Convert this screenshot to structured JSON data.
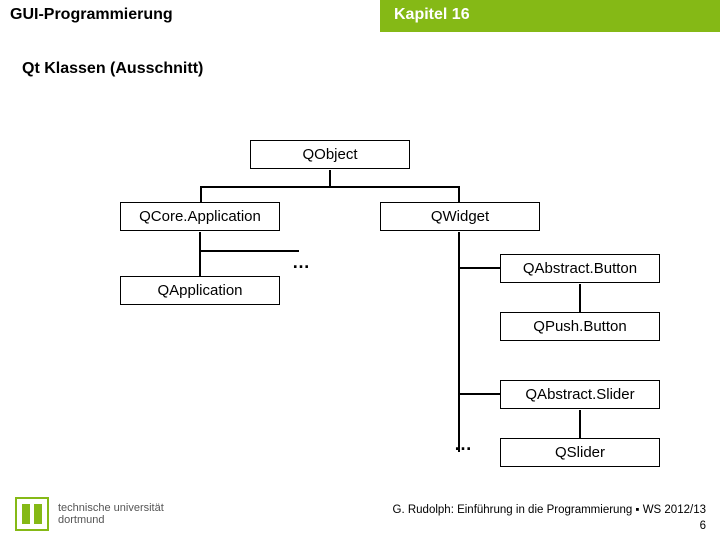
{
  "header": {
    "left": "GUI-Programmierung",
    "right": "Kapitel 16"
  },
  "subtitle": "Qt Klassen (Ausschnitt)",
  "nodes": {
    "qobject": "QObject",
    "qcoreapp": "QCore.Application",
    "qwidget": "QWidget",
    "qapp": "QApplication",
    "qabstractbutton": "QAbstract.Button",
    "qpushbutton": "QPush.Button",
    "qabstractslider": "QAbstract.Slider",
    "qslider": "QSlider"
  },
  "ellipsis": "…",
  "logo": {
    "line1": "technische universität",
    "line2": "dortmund"
  },
  "footer": {
    "text": "G. Rudolph: Einführung in die Programmierung ▪ WS 2012/13",
    "page": "6"
  }
}
